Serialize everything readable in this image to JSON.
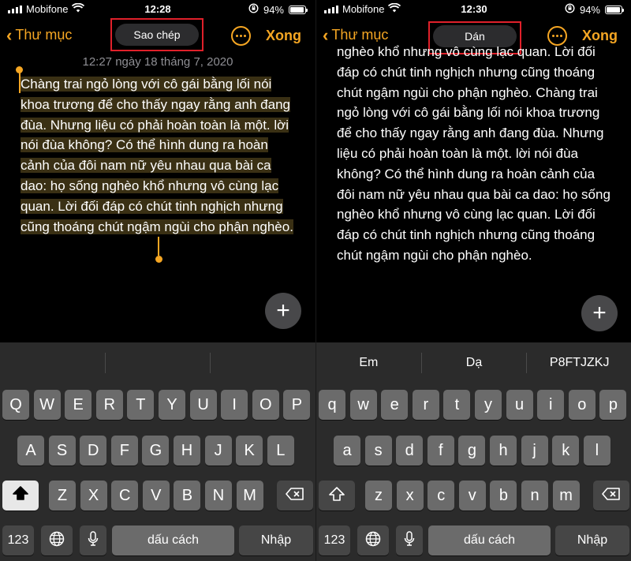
{
  "left": {
    "status": {
      "carrier": "Mobifone",
      "time": "12:28",
      "battery": "94%",
      "battery_level": 0.94
    },
    "nav": {
      "back": "Thư mục",
      "action": "Sao chép",
      "done": "Xong"
    },
    "timestamp": "12:27 ngày 18 tháng 7, 2020",
    "note": "Chàng trai ngỏ lòng với cô gái bằng lối nói khoa trương để cho thấy ngay rằng anh đang đùa. Nhưng liệu có phải hoàn toàn là một. lời nói đùa không? Có thể hình dung ra hoàn cảnh của đôi nam nữ yêu nhau qua bài ca dao: họ sống nghèo khổ nhưng vô cùng lạc quan. Lời đối đáp có chút tinh nghịch nhưng cũng thoáng chút ngậm ngùi cho phận nghèo.",
    "suggestions": [
      "",
      "",
      ""
    ],
    "keys": {
      "row1": [
        "Q",
        "W",
        "E",
        "R",
        "T",
        "Y",
        "U",
        "I",
        "O",
        "P"
      ],
      "row2": [
        "A",
        "S",
        "D",
        "F",
        "G",
        "H",
        "J",
        "K",
        "L"
      ],
      "row3": [
        "Z",
        "X",
        "C",
        "V",
        "B",
        "N",
        "M"
      ],
      "num": "123",
      "space": "dấu cách",
      "enter": "Nhập"
    }
  },
  "right": {
    "status": {
      "carrier": "Mobifone",
      "time": "12:30",
      "battery": "94%",
      "battery_level": 0.94
    },
    "nav": {
      "back": "Thư mục",
      "action": "Dán",
      "done": "Xong"
    },
    "note": "nghèo khổ nhưng vô cùng lạc quan. Lời đối đáp có chút tinh nghịch nhưng cũng thoáng chút ngậm ngùi cho phận nghèo. Chàng trai ngỏ lòng với cô gái bằng lối nói khoa trương để cho thấy ngay rằng anh đang đùa. Nhưng liệu có phải hoàn toàn là một. lời nói đùa không? Có thể hình dung ra hoàn cảnh của đôi nam nữ yêu nhau qua bài ca dao: họ sống nghèo khổ nhưng vô cùng lạc quan. Lời đối đáp có chút tinh nghịch nhưng cũng thoáng chút ngậm ngùi cho phận nghèo.",
    "suggestions": [
      "Em",
      "Dạ",
      "P8FTJZKJ"
    ],
    "keys": {
      "row1": [
        "q",
        "w",
        "e",
        "r",
        "t",
        "y",
        "u",
        "i",
        "o",
        "p"
      ],
      "row2": [
        "a",
        "s",
        "d",
        "f",
        "g",
        "h",
        "j",
        "k",
        "l"
      ],
      "row3": [
        "z",
        "x",
        "c",
        "v",
        "b",
        "n",
        "m"
      ],
      "num": "123",
      "space": "dấu cách",
      "enter": "Nhập"
    }
  },
  "colors": {
    "accent": "#f5a623",
    "highlight_box": "#e0202a",
    "selection": "#3a3014"
  }
}
